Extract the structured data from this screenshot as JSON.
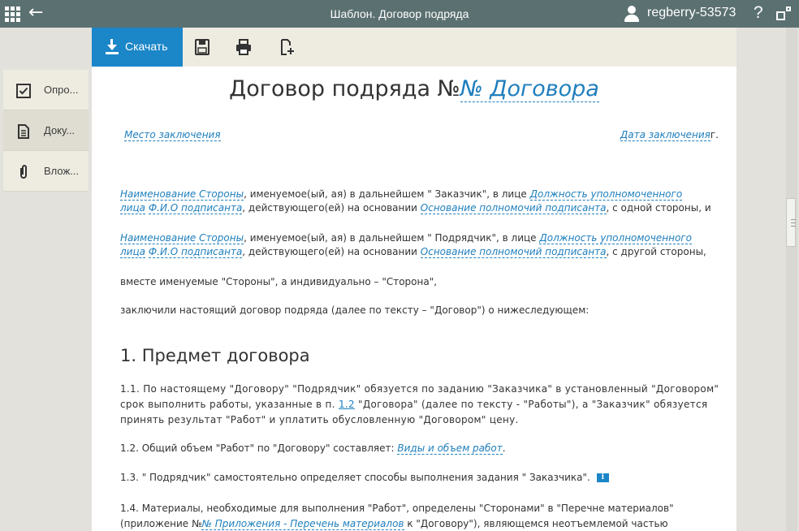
{
  "window": {
    "title": "Шаблон. Договор подряда",
    "user": "regberry-53573",
    "help": "?"
  },
  "toolbar": {
    "download_label": "Скачать",
    "icons": [
      "save-icon",
      "print-icon",
      "add-document-icon"
    ]
  },
  "sidebar": {
    "items": [
      {
        "label": "Опро...",
        "icon": "checkbox-icon"
      },
      {
        "label": "Доку...",
        "icon": "document-icon"
      },
      {
        "label": "Влож...",
        "icon": "paperclip-icon"
      }
    ]
  },
  "document": {
    "title_prefix": "Договор подряда №",
    "title_field": "№ Договора",
    "place_field": "Место заключения",
    "date_field": "Дата заключения",
    "date_suffix": "г.",
    "party1": {
      "name": "Наименование Стороны",
      "text1": ", именуемое(ый, ая) в дальнейшем \" Заказчик\", в лице",
      "position_a": "Должность уполномоченного",
      "position_b": "лица",
      "signer": "Ф.И.О подписанта",
      "text2": ", действующего(ей) на основании",
      "basis": "Основание полномочий подписанта",
      "text3": ", с одной стороны, и"
    },
    "party2": {
      "name": "Наименование Стороны",
      "text1": ", именуемое(ый, ая) в дальнейшем \" Подрядчик\", в лице",
      "position_a": "Должность уполномоченного",
      "position_b": "лица",
      "signer": "Ф.И.О подписанта",
      "text2": ", действующего(ей) на основании",
      "basis": "Основание полномочий подписанта",
      "text3": ", с другой стороны,"
    },
    "together": "вместе именуемые \"Стороны\", а индивидуально – \"Сторона\",",
    "concluded": "заключили настоящий договор подряда (далее по тексту – \"Договор\") о нижеследующем:",
    "section1_title": "1. Предмет договора",
    "p11_a": "1.1. По настоящему \"Договору\" \"Подрядчик\" обязуется по заданию \"Заказчика\" в установленный \"Договором\" срок выполнить работы, указанные в п.",
    "p11_link": "1.2",
    "p11_b": "\"Договора\" (далее по тексту - \"Работы\"), а \"Заказчик\" обязуется принять результат \"Работ\" и уплатить обусловленную \"Договором\" цену.",
    "p12_a": "1.2. Общий объем \"Работ\" по \"Договору\" составляет:",
    "p12_field": "Виды и объем работ",
    "p12_b": ".",
    "p13": "1.3. \" Подрядчик\" самостоятельно определяет способы выполнения задания \" Заказчика\".",
    "p13_info": "i",
    "p14_a": "1.4. Материалы, необходимые для выполнения \"Работ\", определены \"Сторонами\" в \"Перечне материалов\" (приложение №",
    "p14_field": "№ Приложения - Перечень материалов",
    "p14_b": "к \"Договору\"), являющемся неотъемлемой частью \"Договора\"."
  },
  "colors": {
    "topbar": "#5b7071",
    "accent": "#1b86c8",
    "field": "#1f7fbd",
    "toolbar": "#eeece1",
    "background": "#e2e1dc"
  }
}
